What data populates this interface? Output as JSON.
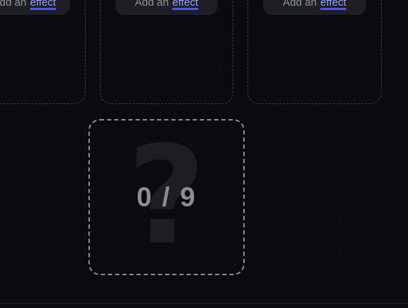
{
  "effect_slots": [
    {
      "prefix": "Add an",
      "link": "effect"
    },
    {
      "prefix": "Add an",
      "link": "effect"
    },
    {
      "prefix": "Add an",
      "link": "effect"
    }
  ],
  "main_slot": {
    "counter": "0 / 9",
    "placeholder_glyph": "?"
  },
  "colors": {
    "background": "#0a0b0e",
    "pill": "#1d1f24",
    "link_underline": "#5252f2",
    "dashed_border": "#8a8d94"
  }
}
